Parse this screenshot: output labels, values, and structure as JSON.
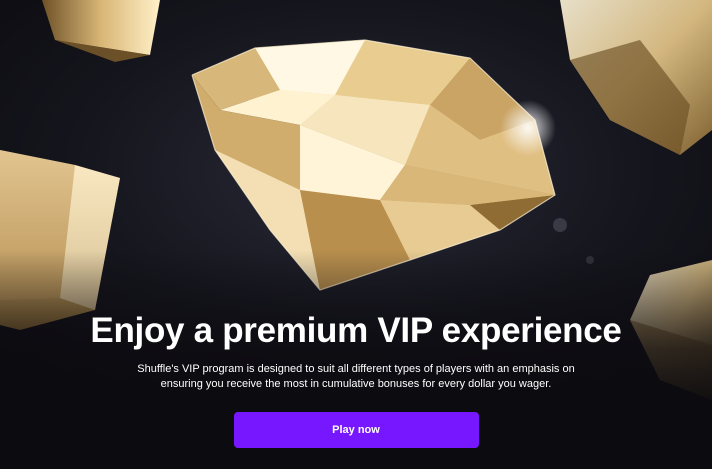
{
  "hero": {
    "headline": "Enjoy a premium VIP experience",
    "description": "Shuffle's VIP program is designed to suit all different types of players with an emphasis on ensuring you receive the most in cumulative bonuses for every dollar you wager.",
    "cta_label": "Play now"
  },
  "colors": {
    "cta_background": "#7717ff",
    "page_background": "#0c0b10",
    "gold": "#e8c98a"
  },
  "illustration": {
    "subject": "golden diamond and gold gem shapes"
  }
}
